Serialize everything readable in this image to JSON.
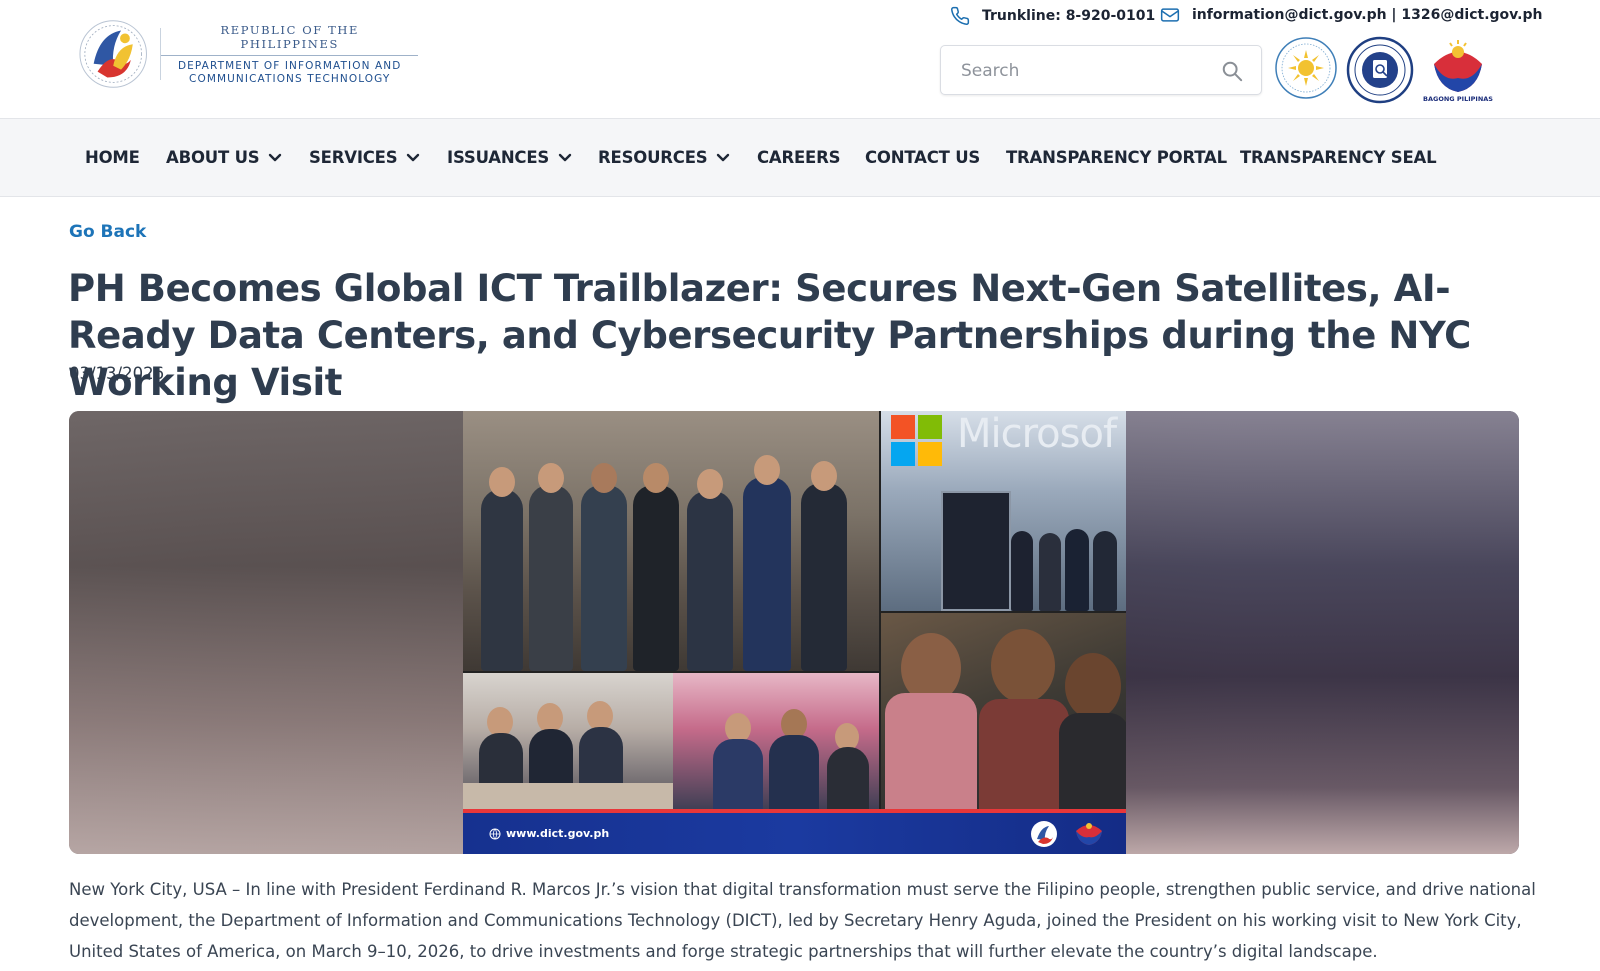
{
  "header": {
    "logo": {
      "republic": "REPUBLIC OF THE PHILIPPINES",
      "department_line1": "DEPARTMENT OF INFORMATION AND",
      "department_line2": "COMMUNICATIONS TECHNOLOGY"
    },
    "trunkline": "Trunkline: 8-920-0101",
    "email": "information@dict.gov.ph | 1326@dict.gov.ph",
    "search": {
      "placeholder": "Search",
      "value": ""
    },
    "badges": [
      "transparency-seal",
      "freedom-of-information",
      "bagong-pilipinas"
    ],
    "bagong_pilipinas_label": "BAGONG PILIPINAS"
  },
  "nav": {
    "items": [
      {
        "label": "HOME",
        "dropdown": false
      },
      {
        "label": "ABOUT US",
        "dropdown": true
      },
      {
        "label": "SERVICES",
        "dropdown": true
      },
      {
        "label": "ISSUANCES",
        "dropdown": true
      },
      {
        "label": "RESOURCES",
        "dropdown": true
      },
      {
        "label": "CAREERS",
        "dropdown": false
      },
      {
        "label": "CONTACT US",
        "dropdown": false
      },
      {
        "label": "TRANSPARENCY PORTAL",
        "dropdown": false
      },
      {
        "label": "TRANSPARENCY SEAL",
        "dropdown": false
      }
    ]
  },
  "article": {
    "go_back": "Go Back",
    "title": "PH Becomes Global ICT Trailblazer: Secures Next-Gen Satellites, AI-Ready Data Centers, and Cybersecurity Partnerships during the NYC Working Visit",
    "date": "03/13/2026",
    "image": {
      "microsoft_text": "Microsof",
      "url_text": "www.dict.gov.ph"
    },
    "paragraph": "New York City, USA – In line with President Ferdinand R. Marcos Jr.’s vision that digital transformation must serve the Filipino people, strengthen public service, and drive national development, the Department of Information and Communications Technology (DICT), led by Secretary Henry Aguda, joined the President on his working visit to New York City, United States of America, on March 9–10, 2026, to drive investments and forge strategic partnerships that will further elevate the country’s digital landscape."
  },
  "colors": {
    "link": "#1d74b8",
    "title": "#2f3d4f",
    "nav_bg": "#f5f6f8",
    "strip_blue": "#16318f",
    "strip_red": "#e8373a"
  }
}
